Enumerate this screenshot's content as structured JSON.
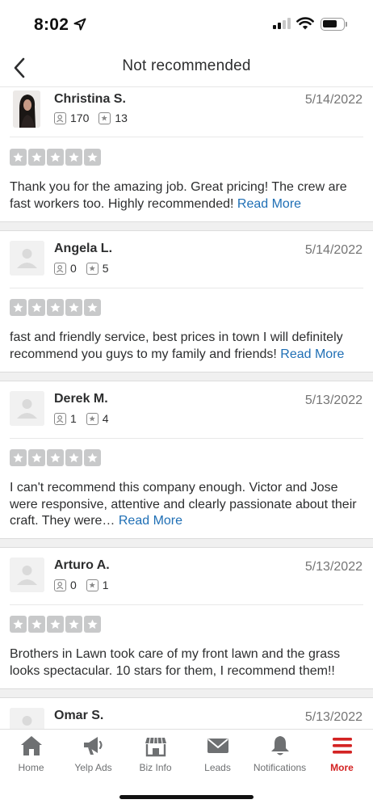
{
  "status_bar": {
    "time": "8:02"
  },
  "nav": {
    "title": "Not recommended"
  },
  "reviews": [
    {
      "name": "Christina S.",
      "date": "5/14/2022",
      "friends": "170",
      "review_count": "13",
      "rating": 5,
      "text": "Thank you for the amazing job. Great pricing! The crew are fast workers too. Highly recommended!",
      "read_more": "Read More"
    },
    {
      "name": "Angela L.",
      "date": "5/14/2022",
      "friends": "0",
      "review_count": "5",
      "rating": 5,
      "text": "fast and friendly service, best prices in town I will definitely recommend you guys to my family and friends!",
      "read_more": "Read More"
    },
    {
      "name": "Derek M.",
      "date": "5/13/2022",
      "friends": "1",
      "review_count": "4",
      "rating": 5,
      "text": "I can't recommend this company enough. Victor and Jose were responsive, attentive and clearly passionate about their craft. They were…",
      "read_more": "Read More"
    },
    {
      "name": "Arturo A.",
      "date": "5/13/2022",
      "friends": "0",
      "review_count": "1",
      "rating": 5,
      "text": "Brothers in Lawn took care of my front lawn and the grass looks spectacular. 10 stars for them, I recommend them!!",
      "read_more": ""
    },
    {
      "name": "Omar S.",
      "date": "5/13/2022"
    }
  ],
  "tabs": [
    {
      "label": "Home",
      "icon": "home-icon"
    },
    {
      "label": "Yelp Ads",
      "icon": "megaphone-icon"
    },
    {
      "label": "Biz Info",
      "icon": "storefront-icon"
    },
    {
      "label": "Leads",
      "icon": "envelope-icon"
    },
    {
      "label": "Notifications",
      "icon": "bell-icon"
    },
    {
      "label": "More",
      "icon": "menu-icon",
      "active": true
    }
  ],
  "colors": {
    "accent": "#d32323",
    "link": "#1f6fb5",
    "star_empty": "#c8c9ca"
  }
}
